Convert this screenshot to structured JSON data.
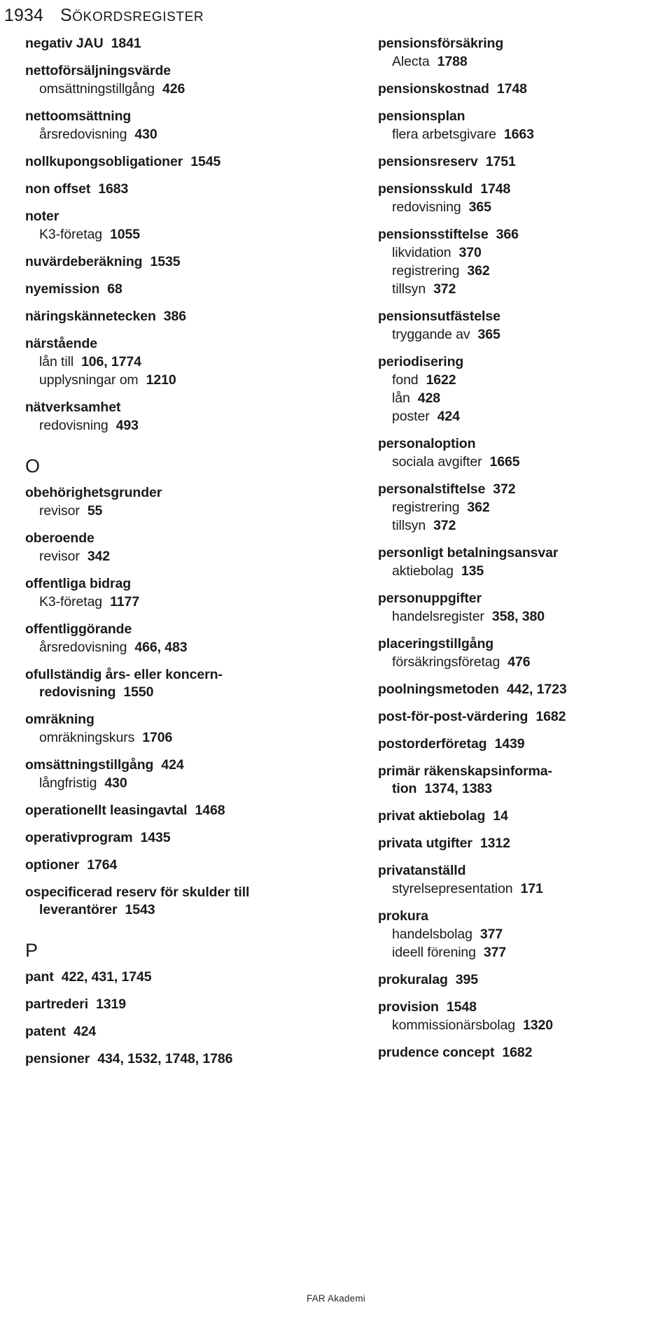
{
  "running_head": {
    "folio": "1934",
    "title_initial": "S",
    "title_rest": "ÖKORDSREGISTER",
    "title_full": "SÖKORDSREGISTER"
  },
  "footer": {
    "publisher": "FAR Akademi"
  },
  "columns": [
    {
      "name": "left-column",
      "blocks": [
        {
          "type": "entry",
          "lines": [
            {
              "kind": "main",
              "term": "negativ JAU",
              "pages": "1841"
            }
          ]
        },
        {
          "type": "entry",
          "lines": [
            {
              "kind": "main",
              "term": "nettoförsäljningsvärde",
              "pages": ""
            },
            {
              "kind": "sub",
              "term": "omsättningstillgång",
              "pages": "426"
            }
          ]
        },
        {
          "type": "entry",
          "lines": [
            {
              "kind": "main",
              "term": "nettoomsättning",
              "pages": ""
            },
            {
              "kind": "sub",
              "term": "årsredovisning",
              "pages": "430"
            }
          ]
        },
        {
          "type": "entry",
          "lines": [
            {
              "kind": "main",
              "term": "nollkupongsobligationer",
              "pages": "1545"
            }
          ]
        },
        {
          "type": "entry",
          "lines": [
            {
              "kind": "main",
              "term": "non offset",
              "pages": "1683"
            }
          ]
        },
        {
          "type": "entry",
          "lines": [
            {
              "kind": "main",
              "term": "noter",
              "pages": ""
            },
            {
              "kind": "sub",
              "term": "K3-företag",
              "pages": "1055"
            }
          ]
        },
        {
          "type": "entry",
          "lines": [
            {
              "kind": "main",
              "term": "nuvärdeberäkning",
              "pages": "1535"
            }
          ]
        },
        {
          "type": "entry",
          "lines": [
            {
              "kind": "main",
              "term": "nyemission",
              "pages": "68"
            }
          ]
        },
        {
          "type": "entry",
          "lines": [
            {
              "kind": "main",
              "term": "näringskännetecken",
              "pages": "386"
            }
          ]
        },
        {
          "type": "entry",
          "lines": [
            {
              "kind": "main",
              "term": "närstående",
              "pages": ""
            },
            {
              "kind": "sub",
              "term": "lån till",
              "pages": "106, 1774"
            },
            {
              "kind": "sub",
              "term": "upplysningar om",
              "pages": "1210"
            }
          ]
        },
        {
          "type": "entry",
          "lines": [
            {
              "kind": "main",
              "term": "nätverksamhet",
              "pages": ""
            },
            {
              "kind": "sub",
              "term": "redovisning",
              "pages": "493"
            }
          ]
        },
        {
          "type": "letter",
          "letter": "O"
        },
        {
          "type": "entry",
          "lines": [
            {
              "kind": "main",
              "term": "obehörighetsgrunder",
              "pages": ""
            },
            {
              "kind": "sub",
              "term": "revisor",
              "pages": "55"
            }
          ]
        },
        {
          "type": "entry",
          "lines": [
            {
              "kind": "main",
              "term": "oberoende",
              "pages": ""
            },
            {
              "kind": "sub",
              "term": "revisor",
              "pages": "342"
            }
          ]
        },
        {
          "type": "entry",
          "lines": [
            {
              "kind": "main",
              "term": "offentliga bidrag",
              "pages": ""
            },
            {
              "kind": "sub",
              "term": "K3-företag",
              "pages": "1177"
            }
          ]
        },
        {
          "type": "entry",
          "lines": [
            {
              "kind": "main",
              "term": "offentliggörande",
              "pages": ""
            },
            {
              "kind": "sub",
              "term": "årsredovisning",
              "pages": "466, 483"
            }
          ]
        },
        {
          "type": "entry",
          "lines": [
            {
              "kind": "main",
              "term": "ofullständig års- eller koncern-",
              "pages": ""
            },
            {
              "kind": "cont",
              "term": "redovisning",
              "pages": "1550"
            }
          ]
        },
        {
          "type": "entry",
          "lines": [
            {
              "kind": "main",
              "term": "omräkning",
              "pages": ""
            },
            {
              "kind": "sub",
              "term": "omräkningskurs",
              "pages": "1706"
            }
          ]
        },
        {
          "type": "entry",
          "lines": [
            {
              "kind": "main",
              "term": "omsättningstillgång",
              "pages": "424"
            },
            {
              "kind": "sub",
              "term": "långfristig",
              "pages": "430"
            }
          ]
        },
        {
          "type": "entry",
          "lines": [
            {
              "kind": "main",
              "term": "operationellt leasingavtal",
              "pages": "1468"
            }
          ]
        },
        {
          "type": "entry",
          "lines": [
            {
              "kind": "main",
              "term": "operativprogram",
              "pages": "1435"
            }
          ]
        },
        {
          "type": "entry",
          "lines": [
            {
              "kind": "main",
              "term": "optioner",
              "pages": "1764"
            }
          ]
        },
        {
          "type": "entry",
          "lines": [
            {
              "kind": "main",
              "term": "ospecificerad reserv för skulder till",
              "pages": ""
            },
            {
              "kind": "cont",
              "term": "leverantörer",
              "pages": "1543"
            }
          ]
        },
        {
          "type": "letter",
          "letter": "P"
        },
        {
          "type": "entry",
          "lines": [
            {
              "kind": "main",
              "term": "pant",
              "pages": "422, 431, 1745"
            }
          ]
        },
        {
          "type": "entry",
          "lines": [
            {
              "kind": "main",
              "term": "partrederi",
              "pages": "1319"
            }
          ]
        },
        {
          "type": "entry",
          "lines": [
            {
              "kind": "main",
              "term": "patent",
              "pages": "424"
            }
          ]
        },
        {
          "type": "entry",
          "lines": [
            {
              "kind": "main",
              "term": "pensioner",
              "pages": "434, 1532, 1748, 1786"
            }
          ]
        }
      ]
    },
    {
      "name": "right-column",
      "blocks": [
        {
          "type": "entry",
          "lines": [
            {
              "kind": "main",
              "term": "pensionsförsäkring",
              "pages": ""
            },
            {
              "kind": "sub",
              "term": "Alecta",
              "pages": "1788"
            }
          ]
        },
        {
          "type": "entry",
          "lines": [
            {
              "kind": "main",
              "term": "pensionskostnad",
              "pages": "1748"
            }
          ]
        },
        {
          "type": "entry",
          "lines": [
            {
              "kind": "main",
              "term": "pensionsplan",
              "pages": ""
            },
            {
              "kind": "sub",
              "term": "flera arbetsgivare",
              "pages": "1663"
            }
          ]
        },
        {
          "type": "entry",
          "lines": [
            {
              "kind": "main",
              "term": "pensionsreserv",
              "pages": "1751"
            }
          ]
        },
        {
          "type": "entry",
          "lines": [
            {
              "kind": "main",
              "term": "pensionsskuld",
              "pages": "1748"
            },
            {
              "kind": "sub",
              "term": "redovisning",
              "pages": "365"
            }
          ]
        },
        {
          "type": "entry",
          "lines": [
            {
              "kind": "main",
              "term": "pensionsstiftelse",
              "pages": "366"
            },
            {
              "kind": "sub",
              "term": "likvidation",
              "pages": "370"
            },
            {
              "kind": "sub",
              "term": "registrering",
              "pages": "362"
            },
            {
              "kind": "sub",
              "term": "tillsyn",
              "pages": "372"
            }
          ]
        },
        {
          "type": "entry",
          "lines": [
            {
              "kind": "main",
              "term": "pensionsutfästelse",
              "pages": ""
            },
            {
              "kind": "sub",
              "term": "tryggande av",
              "pages": "365"
            }
          ]
        },
        {
          "type": "entry",
          "lines": [
            {
              "kind": "main",
              "term": "periodisering",
              "pages": ""
            },
            {
              "kind": "sub",
              "term": "fond",
              "pages": "1622"
            },
            {
              "kind": "sub",
              "term": "lån",
              "pages": "428"
            },
            {
              "kind": "sub",
              "term": "poster",
              "pages": "424"
            }
          ]
        },
        {
          "type": "entry",
          "lines": [
            {
              "kind": "main",
              "term": "personaloption",
              "pages": ""
            },
            {
              "kind": "sub",
              "term": "sociala avgifter",
              "pages": "1665"
            }
          ]
        },
        {
          "type": "entry",
          "lines": [
            {
              "kind": "main",
              "term": "personalstiftelse",
              "pages": "372"
            },
            {
              "kind": "sub",
              "term": "registrering",
              "pages": "362"
            },
            {
              "kind": "sub",
              "term": "tillsyn",
              "pages": "372"
            }
          ]
        },
        {
          "type": "entry",
          "lines": [
            {
              "kind": "main",
              "term": "personligt betalningsansvar",
              "pages": ""
            },
            {
              "kind": "sub",
              "term": "aktiebolag",
              "pages": "135"
            }
          ]
        },
        {
          "type": "entry",
          "lines": [
            {
              "kind": "main",
              "term": "personuppgifter",
              "pages": ""
            },
            {
              "kind": "sub",
              "term": "handelsregister",
              "pages": "358, 380"
            }
          ]
        },
        {
          "type": "entry",
          "lines": [
            {
              "kind": "main",
              "term": "placeringstillgång",
              "pages": ""
            },
            {
              "kind": "sub",
              "term": "försäkringsföretag",
              "pages": "476"
            }
          ]
        },
        {
          "type": "entry",
          "lines": [
            {
              "kind": "main",
              "term": "poolningsmetoden",
              "pages": "442, 1723"
            }
          ]
        },
        {
          "type": "entry",
          "lines": [
            {
              "kind": "main",
              "term": "post-för-post-värdering",
              "pages": "1682"
            }
          ]
        },
        {
          "type": "entry",
          "lines": [
            {
              "kind": "main",
              "term": "postorderföretag",
              "pages": "1439"
            }
          ]
        },
        {
          "type": "entry",
          "lines": [
            {
              "kind": "main",
              "term": "primär räkenskapsinforma-",
              "pages": ""
            },
            {
              "kind": "cont",
              "term": "tion",
              "pages": "1374, 1383"
            }
          ]
        },
        {
          "type": "entry",
          "lines": [
            {
              "kind": "main",
              "term": "privat aktiebolag",
              "pages": "14"
            }
          ]
        },
        {
          "type": "entry",
          "lines": [
            {
              "kind": "main",
              "term": "privata utgifter",
              "pages": "1312"
            }
          ]
        },
        {
          "type": "entry",
          "lines": [
            {
              "kind": "main",
              "term": "privatanställd",
              "pages": ""
            },
            {
              "kind": "sub",
              "term": "styrelsepresentation",
              "pages": "171"
            }
          ]
        },
        {
          "type": "entry",
          "lines": [
            {
              "kind": "main",
              "term": "prokura",
              "pages": ""
            },
            {
              "kind": "sub",
              "term": "handelsbolag",
              "pages": "377"
            },
            {
              "kind": "sub",
              "term": "ideell förening",
              "pages": "377"
            }
          ]
        },
        {
          "type": "entry",
          "lines": [
            {
              "kind": "main",
              "term": "prokuralag",
              "pages": "395"
            }
          ]
        },
        {
          "type": "entry",
          "lines": [
            {
              "kind": "main",
              "term": "provision",
              "pages": "1548"
            },
            {
              "kind": "sub",
              "term": "kommissionärsbolag",
              "pages": "1320"
            }
          ]
        },
        {
          "type": "entry",
          "lines": [
            {
              "kind": "main",
              "term": "prudence concept",
              "pages": "1682"
            }
          ]
        }
      ]
    }
  ]
}
